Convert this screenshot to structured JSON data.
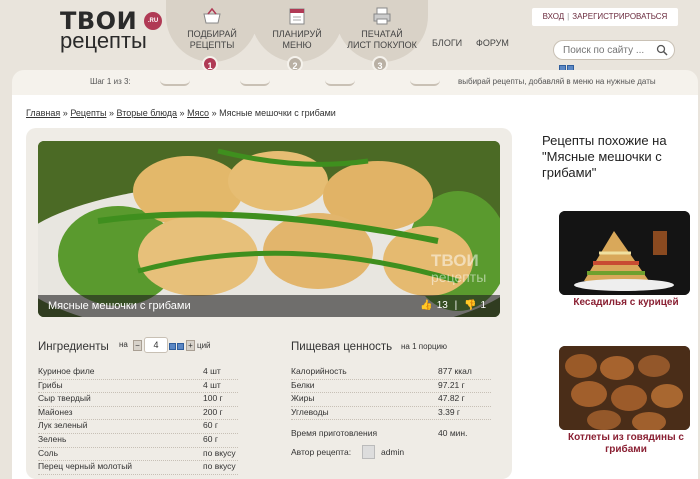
{
  "logo": {
    "top": "ТВОИ",
    "bottom": "рецепты",
    "badge": ".RU"
  },
  "nav": {
    "tabs": [
      {
        "icon": "basket-icon",
        "line1": "подбирай",
        "line2": "рецепты"
      },
      {
        "icon": "calendar-icon",
        "line1": "планируй",
        "line2": "меню"
      },
      {
        "icon": "printer-icon",
        "line1": "печатай",
        "line2": "лист покупок"
      }
    ],
    "links": [
      "Блоги",
      "Форум"
    ]
  },
  "auth": {
    "login": "Вход",
    "register": "Зарегистрироваться"
  },
  "search": {
    "placeholder": "Поиск по сайту ..."
  },
  "steps": {
    "label": "Шаг 1 из 3:",
    "hint": "выбирай рецепты, добавляй в меню на нужные даты",
    "numbers": [
      "1",
      "2",
      "3"
    ],
    "active": 1
  },
  "breadcrumb": {
    "items": [
      "Главная",
      "Рецепты",
      "Вторые блюда",
      "Мясо"
    ],
    "sep": "»",
    "current": "Мясные мешочки с грибами"
  },
  "recipe": {
    "title": "Мясные мешочки с грибами",
    "likes": "13",
    "dislikes": "1",
    "watermark_top": "ТВОИ",
    "watermark_bottom": "рецепты"
  },
  "ingredients": {
    "title": "Ингредиенты",
    "portion_prefix": "на",
    "portions": "4",
    "portion_suffix": "ций",
    "items": [
      {
        "name": "Куриное филе",
        "value": "4 шт"
      },
      {
        "name": "Грибы",
        "value": "4 шт"
      },
      {
        "name": "Сыр твердый",
        "value": "100 г"
      },
      {
        "name": "Майонез",
        "value": "200 г"
      },
      {
        "name": "Лук зеленый",
        "value": "60 г"
      },
      {
        "name": "Зелень",
        "value": "60 г"
      },
      {
        "name": "Соль",
        "value": "по вкусу"
      },
      {
        "name": "Перец черный молотый",
        "value": "по вкусу"
      }
    ]
  },
  "nutrition": {
    "title": "Пищевая ценность",
    "subtitle": "на 1 порцию",
    "items": [
      {
        "name": "Калорийность",
        "value": "877 ккал"
      },
      {
        "name": "Белки",
        "value": "97.21 г"
      },
      {
        "name": "Жиры",
        "value": "47.82 г"
      },
      {
        "name": "Углеводы",
        "value": "3.39 г"
      }
    ],
    "time_label": "Время приготовления",
    "time_value": "40 мин.",
    "author_label": "Автор рецепта:",
    "author_name": "admin"
  },
  "sidebar": {
    "title": "Рецепты похожие на \"Мясные мешочки с грибами\"",
    "items": [
      {
        "label": "Кесадилья с курицей"
      },
      {
        "label": "Котлеты из говядины с грибами"
      }
    ]
  },
  "colors": {
    "accent": "#b03a55",
    "link": "#8a2033",
    "background": "#e9e4dc"
  }
}
